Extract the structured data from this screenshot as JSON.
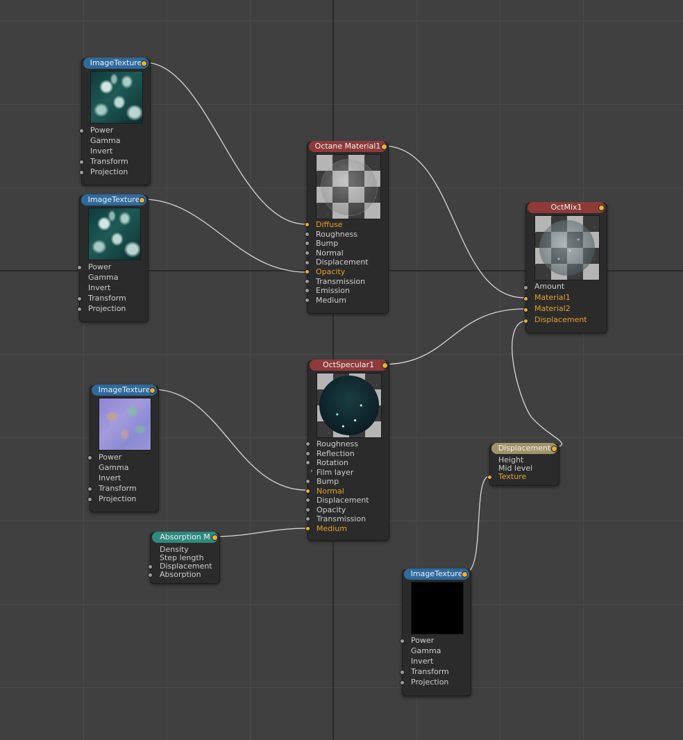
{
  "nodes": {
    "image_texture_1": {
      "title": "ImageTexture",
      "ports": [
        "Power",
        "Gamma",
        "Invert",
        "Transform",
        "Projection"
      ]
    },
    "image_texture_2": {
      "title": "ImageTexture",
      "ports": [
        "Power",
        "Gamma",
        "Invert",
        "Transform",
        "Projection"
      ]
    },
    "image_texture_3": {
      "title": "ImageTexture",
      "ports": [
        "Power",
        "Gamma",
        "Invert",
        "Transform",
        "Projection"
      ]
    },
    "image_texture_4": {
      "title": "ImageTexture",
      "ports": [
        "Power",
        "Gamma",
        "Invert",
        "Transform",
        "Projection"
      ]
    },
    "octane_material": {
      "title": "Octane Material1",
      "ports": [
        "Diffuse",
        "Roughness",
        "Bump",
        "Normal",
        "Displacement",
        "Opacity",
        "Transmission",
        "Emission",
        "Medium"
      ]
    },
    "oct_specular": {
      "title": "OctSpecular1",
      "ports": [
        "Roughness",
        "Reflection",
        "Rotation",
        "Film layer",
        "Bump",
        "Normal",
        "Displacement",
        "Opacity",
        "Transmission",
        "Medium"
      ]
    },
    "oct_mix": {
      "title": "OctMix1",
      "ports": [
        "Amount",
        "Material1",
        "Material2",
        "Displacement"
      ]
    },
    "displacement": {
      "title": "Displacement",
      "ports": [
        "Height",
        "Mid level",
        "Texture"
      ]
    },
    "absorption": {
      "title": "Absorption M",
      "ports": [
        "Density",
        "Step length",
        "Displacement",
        "Absorption"
      ]
    }
  },
  "colors": {
    "background": "#404040",
    "header_texture": "#2e6a9e",
    "header_material": "#8f3a3a",
    "header_medium": "#2e8a7e",
    "header_displacement": "#9f946a",
    "connected_port": "#e3a32a",
    "wire": "#d8d8d8"
  }
}
